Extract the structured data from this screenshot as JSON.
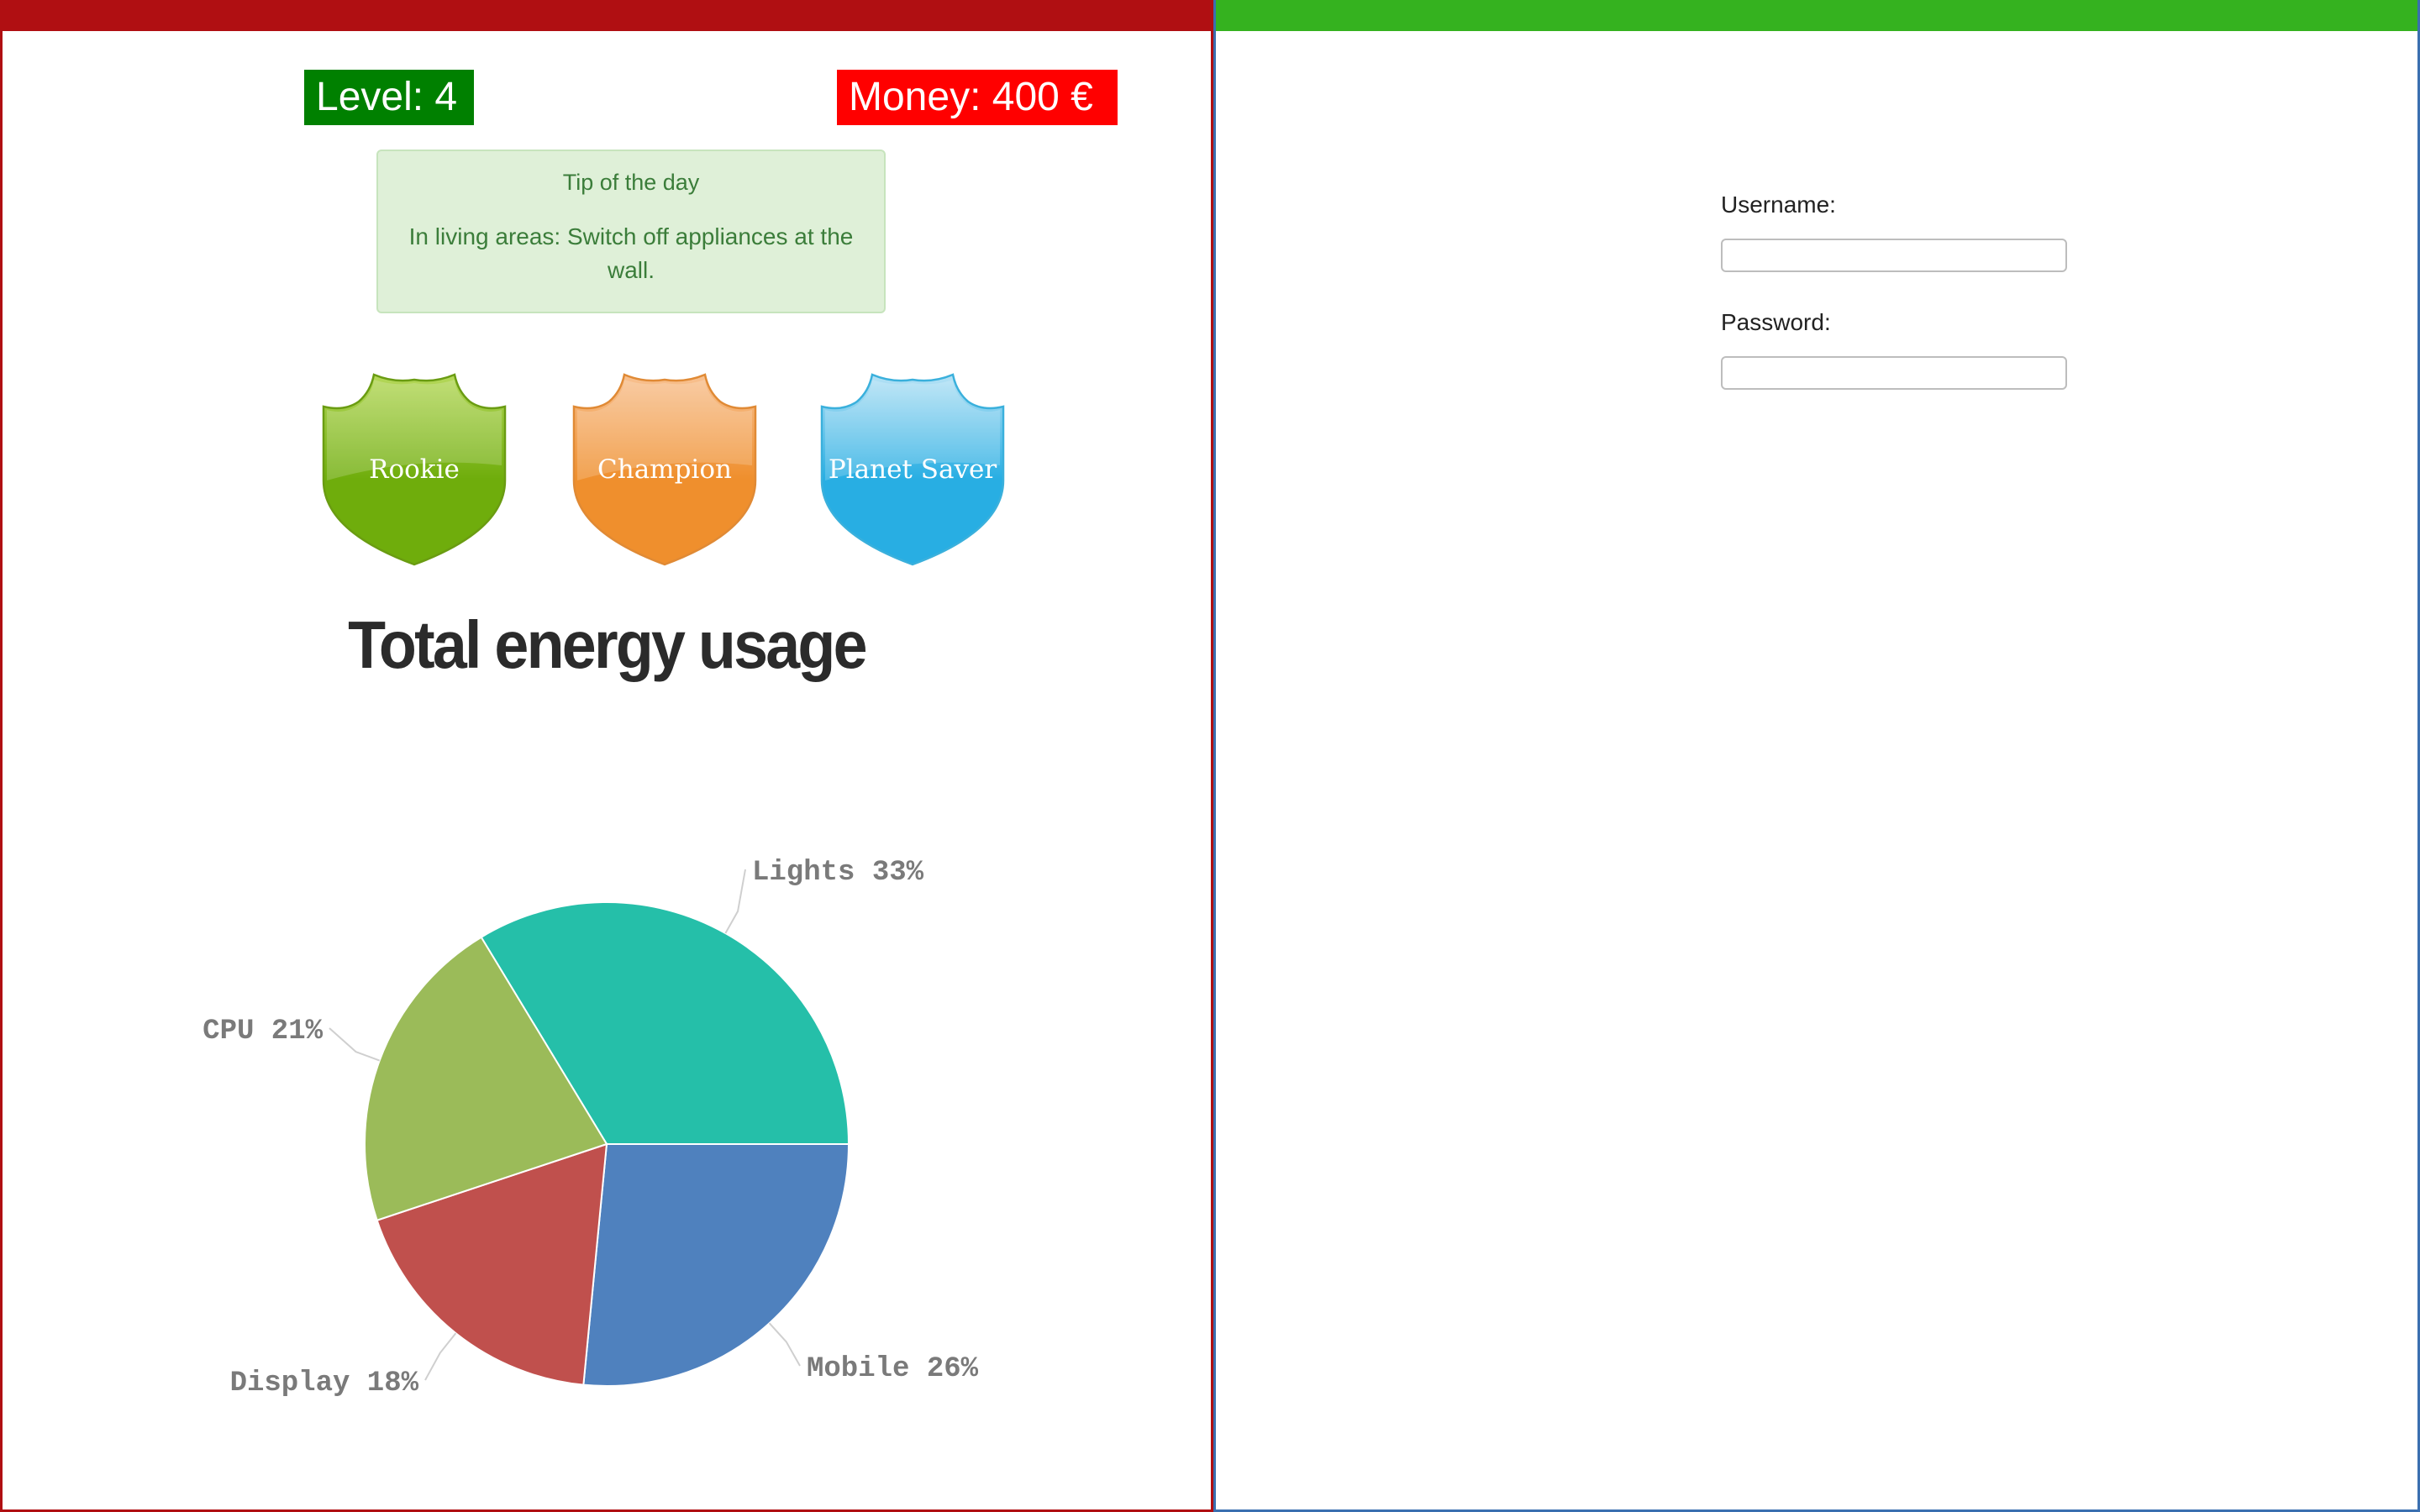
{
  "header": {
    "left_bar_color": "#b00f12",
    "right_bar_color": "#35b21f"
  },
  "stats": {
    "level_label": "Level: 4",
    "level_color": "#008000",
    "money_label": "Money: 400 €",
    "money_color": "#ff0000"
  },
  "tip": {
    "title": "Tip of the day",
    "text": "In living areas: Switch off appliances at the wall.",
    "background": "#dff0d8",
    "text_color": "#3b7d3a"
  },
  "badges": [
    {
      "label": "Rookie",
      "icon": "shield-icon",
      "colors": {
        "top": "#b5d85a",
        "bottom": "#6fad0c",
        "stroke": "#6a9c12"
      }
    },
    {
      "label": "Champion",
      "icon": "shield-icon",
      "colors": {
        "top": "#f8c191",
        "bottom": "#ef8f2d",
        "stroke": "#e08a35"
      }
    },
    {
      "label": "Planet Saver",
      "icon": "shield-icon",
      "colors": {
        "top": "#b6e2f5",
        "bottom": "#28aee3",
        "stroke": "#3ab0dc"
      }
    }
  ],
  "energy_title": "Total energy usage",
  "chart_data": {
    "type": "pie",
    "title": "Total energy usage",
    "slices": [
      {
        "label": "Lights",
        "value": 33,
        "display": "Lights 33%",
        "color": "#25bfa9"
      },
      {
        "label": "Mobile",
        "value": 26,
        "display": "Mobile 26%",
        "color": "#4f81be"
      },
      {
        "label": "Display",
        "value": 18,
        "display": "Display 18%",
        "color": "#c0504d"
      },
      {
        "label": "CPU",
        "value": 21,
        "display": "CPU 21%",
        "color": "#9bbb59"
      }
    ]
  },
  "login": {
    "username_label": "Username:",
    "username_value": "",
    "password_label": "Password:",
    "password_value": ""
  }
}
